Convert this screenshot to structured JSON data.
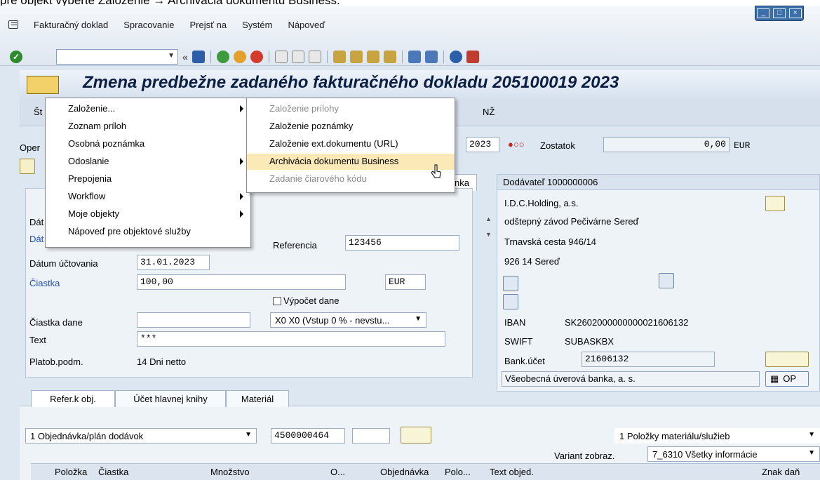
{
  "caption": "pre objekt vyberte Založenie → Archivácia dokumentu Business.",
  "menubar": {
    "items": [
      "Fakturačný doklad",
      "Spracovanie",
      "Prejsť na",
      "Systém",
      "Nápoveď"
    ]
  },
  "title": "Zmena predbežne zadaného fakturačného dokladu 205100019 2023",
  "appbar": {
    "left_label": "Št",
    "right_label": "NŽ"
  },
  "header": {
    "oper_label": "Oper",
    "year": "2023",
    "zostatok_label": "Zostatok",
    "zostatok_value": "0,00",
    "currency": "EUR"
  },
  "tabs_partial": "nka",
  "vendor": {
    "header": "Dodávateľ 1000000006",
    "name": "I.D.C.Holding, a.s.",
    "line2": "odštepný závod Pečivárne Sereď",
    "street": "Trnavská cesta 946/14",
    "city": "926 14 Sereď",
    "iban_label": "IBAN",
    "iban": "SK2602000000000021606132",
    "swift_label": "SWIFT",
    "swift": "SUBASKBX",
    "bank_label": "Bank.účet",
    "bank_account": "21606132",
    "bank_name": "Všeobecná úverová banka, a. s.",
    "op_label": "OP"
  },
  "form": {
    "dat1_label": "Dát",
    "dat2_label": "Dát",
    "referencia_label": "Referencia",
    "referencia": "123456",
    "datum_uctovania_label": "Dátum účtovania",
    "datum_uctovania": "31.01.2023",
    "ciastka_label": "Čiastka",
    "ciastka": "100,00",
    "currency": "EUR",
    "vypocet_dane_label": "Výpočet dane",
    "ciastka_dane_label": "Čiastka dane",
    "tax_code": "X0 X0 (Vstup 0 % - nevstu...",
    "text_label": "Text",
    "text_value": "***",
    "platob_label": "Platob.podm.",
    "platob_value": "14 Dni netto"
  },
  "bottom_tabs": [
    "Refer.k obj.",
    "Účet hlavnej knihy",
    "Materiál"
  ],
  "bottom": {
    "ref_type": "1 Objednávka/plán dodávok",
    "po_number": "4500000464",
    "items_type": "1 Položky materiálu/služieb",
    "variant_label": "Variant zobraz.",
    "variant_value": "7_6310 Všetky informácie"
  },
  "grid_headers": [
    "Položka",
    "Čiastka",
    "Množstvo",
    "O...",
    "Objednávka",
    "Polo...",
    "Text objed.",
    "Znak daň"
  ],
  "context_menu": {
    "items": [
      {
        "label": "Založenie...",
        "submenu": true
      },
      {
        "label": "Zoznam príloh",
        "submenu": false
      },
      {
        "label": "Osobná poznámka",
        "submenu": false
      },
      {
        "label": "Odoslanie",
        "submenu": true
      },
      {
        "label": "Prepojenia",
        "submenu": false
      },
      {
        "label": "Workflow",
        "submenu": true
      },
      {
        "label": "Moje objekty",
        "submenu": true
      },
      {
        "label": "Nápoveď pre objektové služby",
        "submenu": false
      }
    ]
  },
  "submenu": {
    "items": [
      {
        "label": "Založenie prílohy",
        "state": "disabled"
      },
      {
        "label": "Založenie poznámky",
        "state": "normal"
      },
      {
        "label": "Založenie ext.dokumentu (URL)",
        "state": "normal"
      },
      {
        "label": "Archivácia dokumentu Business",
        "state": "highlighted"
      },
      {
        "label": "Zadanie čiarového kódu",
        "state": "disabled"
      }
    ]
  }
}
